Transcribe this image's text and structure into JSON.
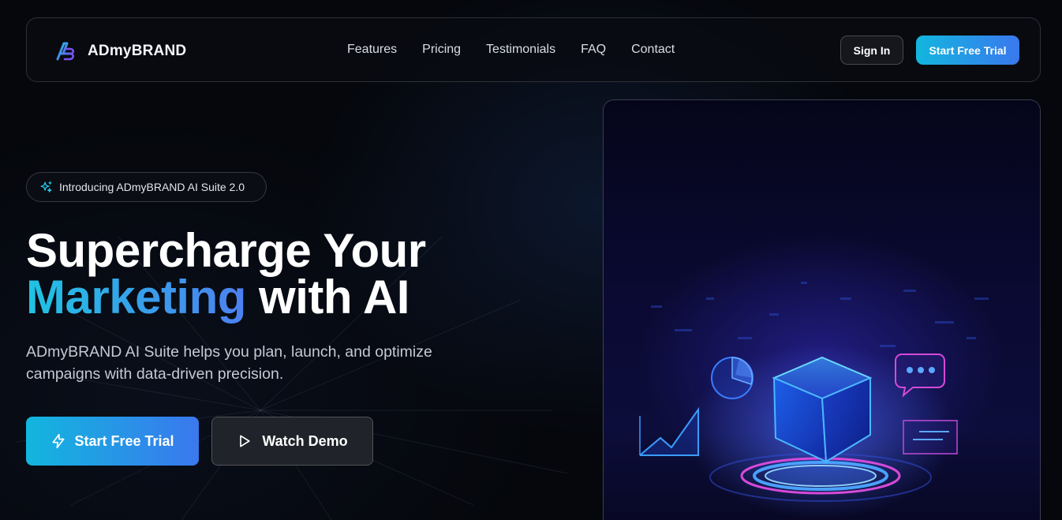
{
  "nav": {
    "brand": "ADmyBRAND",
    "links": [
      "Features",
      "Pricing",
      "Testimonials",
      "FAQ",
      "Contact"
    ],
    "sign_in": "Sign In",
    "trial": "Start Free Trial"
  },
  "hero": {
    "badge": "Introducing ADmyBRAND AI Suite 2.0",
    "headline_line1": "Supercharge Your",
    "headline_highlight": "Marketing",
    "headline_rest": " with AI",
    "subtitle": "ADmyBRAND AI Suite helps you plan, launch, and optimize campaigns with data-driven precision.",
    "cta_primary": "Start Free Trial",
    "cta_secondary": "Watch Demo"
  },
  "colors": {
    "accent_start": "#12b6de",
    "accent_end": "#3a78ee",
    "background": "#05070c"
  },
  "icons": {
    "brand": "brand-logo-icon",
    "badge": "sparkles-icon",
    "cta_primary": "lightning-icon",
    "cta_secondary": "play-icon"
  }
}
